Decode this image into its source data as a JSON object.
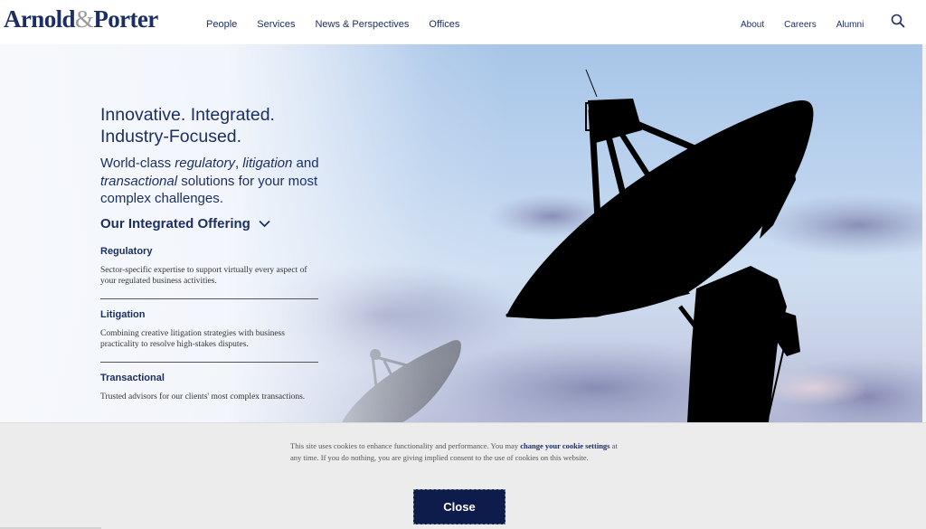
{
  "header": {
    "logo": {
      "part1": "Arnold",
      "amp": "&",
      "part2": "Porter"
    },
    "main_nav": [
      {
        "label": "People"
      },
      {
        "label": "Services"
      },
      {
        "label": "News & Perspectives"
      },
      {
        "label": "Offices"
      }
    ],
    "utility_nav": [
      {
        "label": "About"
      },
      {
        "label": "Careers"
      },
      {
        "label": "Alumni"
      }
    ],
    "search_icon": "search-icon"
  },
  "hero": {
    "headline_line1": "Innovative. Integrated.",
    "headline_line2": "Industry-Focused.",
    "subhead": {
      "t1": "World-class ",
      "em1": "regulatory",
      "t2": ", ",
      "em2": "litigation",
      "t3": " and ",
      "em3": "transactional",
      "t4": " solutions for your most complex challenges."
    },
    "offering_toggle": "Our Integrated Offering",
    "offerings": [
      {
        "title": "Regulatory",
        "description": "Sector-specific expertise to support virtually every aspect of your regulated business activities."
      },
      {
        "title": "Litigation",
        "description": "Combining creative litigation strategies with business practicality to resolve high-stakes disputes."
      },
      {
        "title": "Transactional",
        "description": "Trusted advisors for our clients' most complex transactions."
      }
    ],
    "image_subject": "satellite dishes silhouetted against cloudy sky"
  },
  "cookie_banner": {
    "text_before": "This site uses cookies to enhance functionality and performance. You may ",
    "link": "change your cookie settings",
    "text_after": " at any time. If you do nothing, you are giving implied consent to the use of cookies on this website.",
    "close_label": "Close"
  },
  "colors": {
    "brand_navy": "#1b2f63",
    "button_navy": "#0d1c4b",
    "banner_bg": "#ececec",
    "logo_amp_gray": "#9a9a9a"
  }
}
